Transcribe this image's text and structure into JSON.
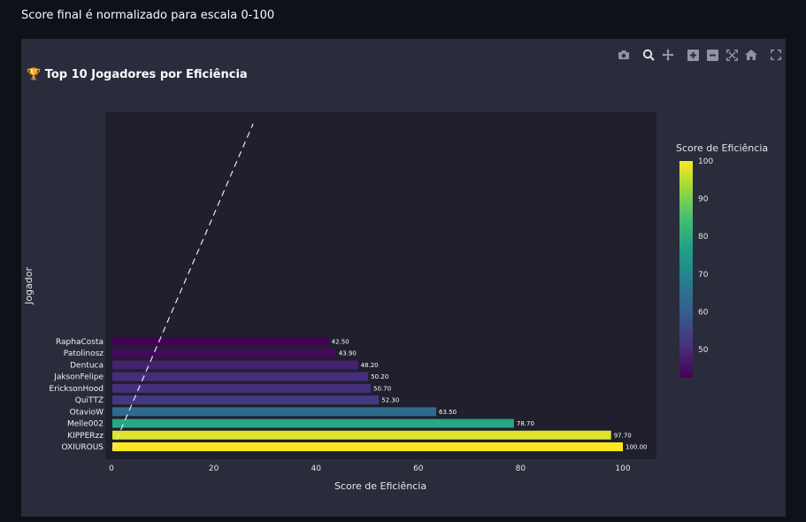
{
  "caption": "Score final é normalizado para escala 0-100",
  "title_icon": "🏆",
  "modebar": [
    "camera-icon",
    "zoom-icon",
    "pan-icon",
    "zoom-in-icon",
    "zoom-out-icon",
    "autoscale-icon",
    "home-icon",
    "fullscreen-icon"
  ],
  "colors": {
    "panel": "#2a2c3c",
    "plot": "#1f1f2e",
    "trend": "#e8e8e8"
  },
  "chart_data": {
    "type": "bar",
    "orientation": "horizontal",
    "title": "Top 10 Jogadores por Eficiência",
    "xlabel": "Score de Eficiência",
    "ylabel": "Jogador",
    "xlim": [
      0,
      105
    ],
    "xticks": [
      "0",
      "20",
      "40",
      "60",
      "80",
      "100"
    ],
    "categories": [
      "RaphaCosta",
      "Patolinosz",
      "Dentuca",
      "JaksonFelipe",
      "EricksonHood",
      "QuiTTZ",
      "OtavioW",
      "Melle002",
      "KIPPERzz",
      "OXIUROUS"
    ],
    "values": [
      42.5,
      43.9,
      48.2,
      50.2,
      50.7,
      52.3,
      63.5,
      78.7,
      97.7,
      100.0
    ],
    "data_labels": [
      "42.50",
      "43.90",
      "48.20",
      "50.20",
      "50.70",
      "52.30",
      "63.50",
      "78.70",
      "97.70",
      "100.00"
    ],
    "colorscale": "viridis",
    "colorbar": {
      "title": "Score de Eficiência",
      "range": [
        42.5,
        100
      ],
      "ticks": [
        "100",
        "90",
        "80",
        "70",
        "60",
        "50"
      ]
    },
    "trend_line": {
      "style": "dashed",
      "color": "#e8e8e8"
    },
    "grid": false
  }
}
